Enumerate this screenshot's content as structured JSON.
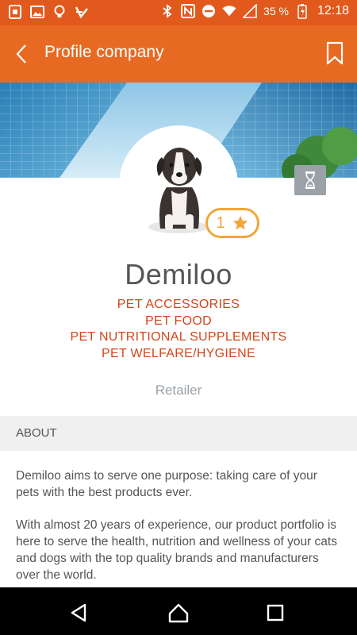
{
  "status_bar": {
    "battery": "35 %",
    "time": "12:18",
    "left_icons": [
      "sim-icon",
      "image-icon",
      "lightbulb-icon",
      "check-icon"
    ],
    "right_icons": [
      "bluetooth-icon",
      "nfc-icon",
      "dnd-icon",
      "wifi-icon",
      "signal-icon",
      "battery-icon"
    ]
  },
  "app_bar": {
    "title": "Profile company",
    "back_icon": "chevron-left-icon",
    "bookmark_icon": "bookmark-icon"
  },
  "profile": {
    "rating": "1",
    "rating_icon": "star-icon",
    "name": "Demiloo",
    "categories": [
      "PET ACCESSORIES",
      "PET FOOD",
      "PET NUTRITIONAL SUPPLEMENTS",
      "PET WELFARE/HYGIENE"
    ],
    "type": "Retailer",
    "status_icon": "hourglass-icon"
  },
  "about": {
    "header": "ABOUT",
    "paragraphs": [
      "Demiloo aims to serve one purpose: taking care of your pets with the best products ever.",
      "With almost 20 years of experience, our product portfolio is here to serve the health, nutrition and wellness of your cats and dogs with the top quality brands and manufacturers over the world."
    ]
  },
  "colors": {
    "status_bar": "#e2591d",
    "app_bar": "#e86a22",
    "category_text": "#d3461a",
    "rating_accent": "#f0a63a"
  }
}
